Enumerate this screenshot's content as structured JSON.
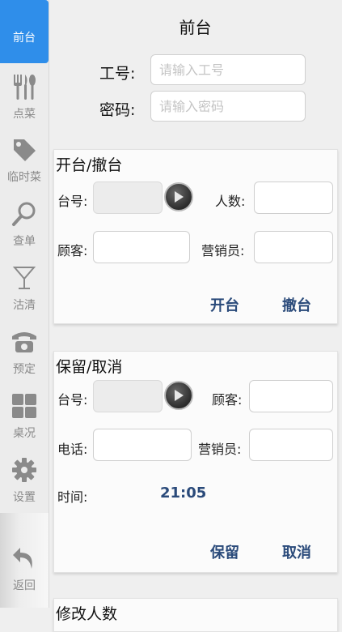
{
  "sidebar": {
    "items": [
      {
        "label": "前台",
        "icon": "front-desk-icon",
        "active": true
      },
      {
        "label": "点菜",
        "icon": "cutlery-icon"
      },
      {
        "label": "临时菜",
        "icon": "tag-icon"
      },
      {
        "label": "查单",
        "icon": "search-icon"
      },
      {
        "label": "沽清",
        "icon": "cocktail-glass-icon"
      },
      {
        "label": "预定",
        "icon": "telephone-icon"
      },
      {
        "label": "桌况",
        "icon": "grid-icon"
      },
      {
        "label": "设置",
        "icon": "gear-icon"
      }
    ],
    "back": {
      "label": "返回",
      "icon": "back-arrow-icon"
    }
  },
  "header": {
    "title": "前台"
  },
  "login": {
    "employee_label": "工号:",
    "employee_placeholder": "请输入工号",
    "password_label": "密码:",
    "password_placeholder": "请输入密码"
  },
  "open_panel": {
    "title": "开台/撤台",
    "table_label": "台号:",
    "people_label": "人数:",
    "customer_label": "顾客:",
    "sales_label": "营销员:",
    "open_btn": "开台",
    "cancel_btn": "撤台"
  },
  "reserve_panel": {
    "title": "保留/取消",
    "table_label": "台号:",
    "customer_label": "顾客:",
    "phone_label": "电话:",
    "sales_label": "营销员:",
    "time_label": "时间:",
    "time_value": "21:05",
    "reserve_btn": "保留",
    "cancel_btn": "取消"
  },
  "next_panel": {
    "title": "修改人数"
  },
  "colors": {
    "accent": "#2f8eea",
    "link": "#2a4a7a",
    "icon_gray": "#8a8a8a"
  }
}
